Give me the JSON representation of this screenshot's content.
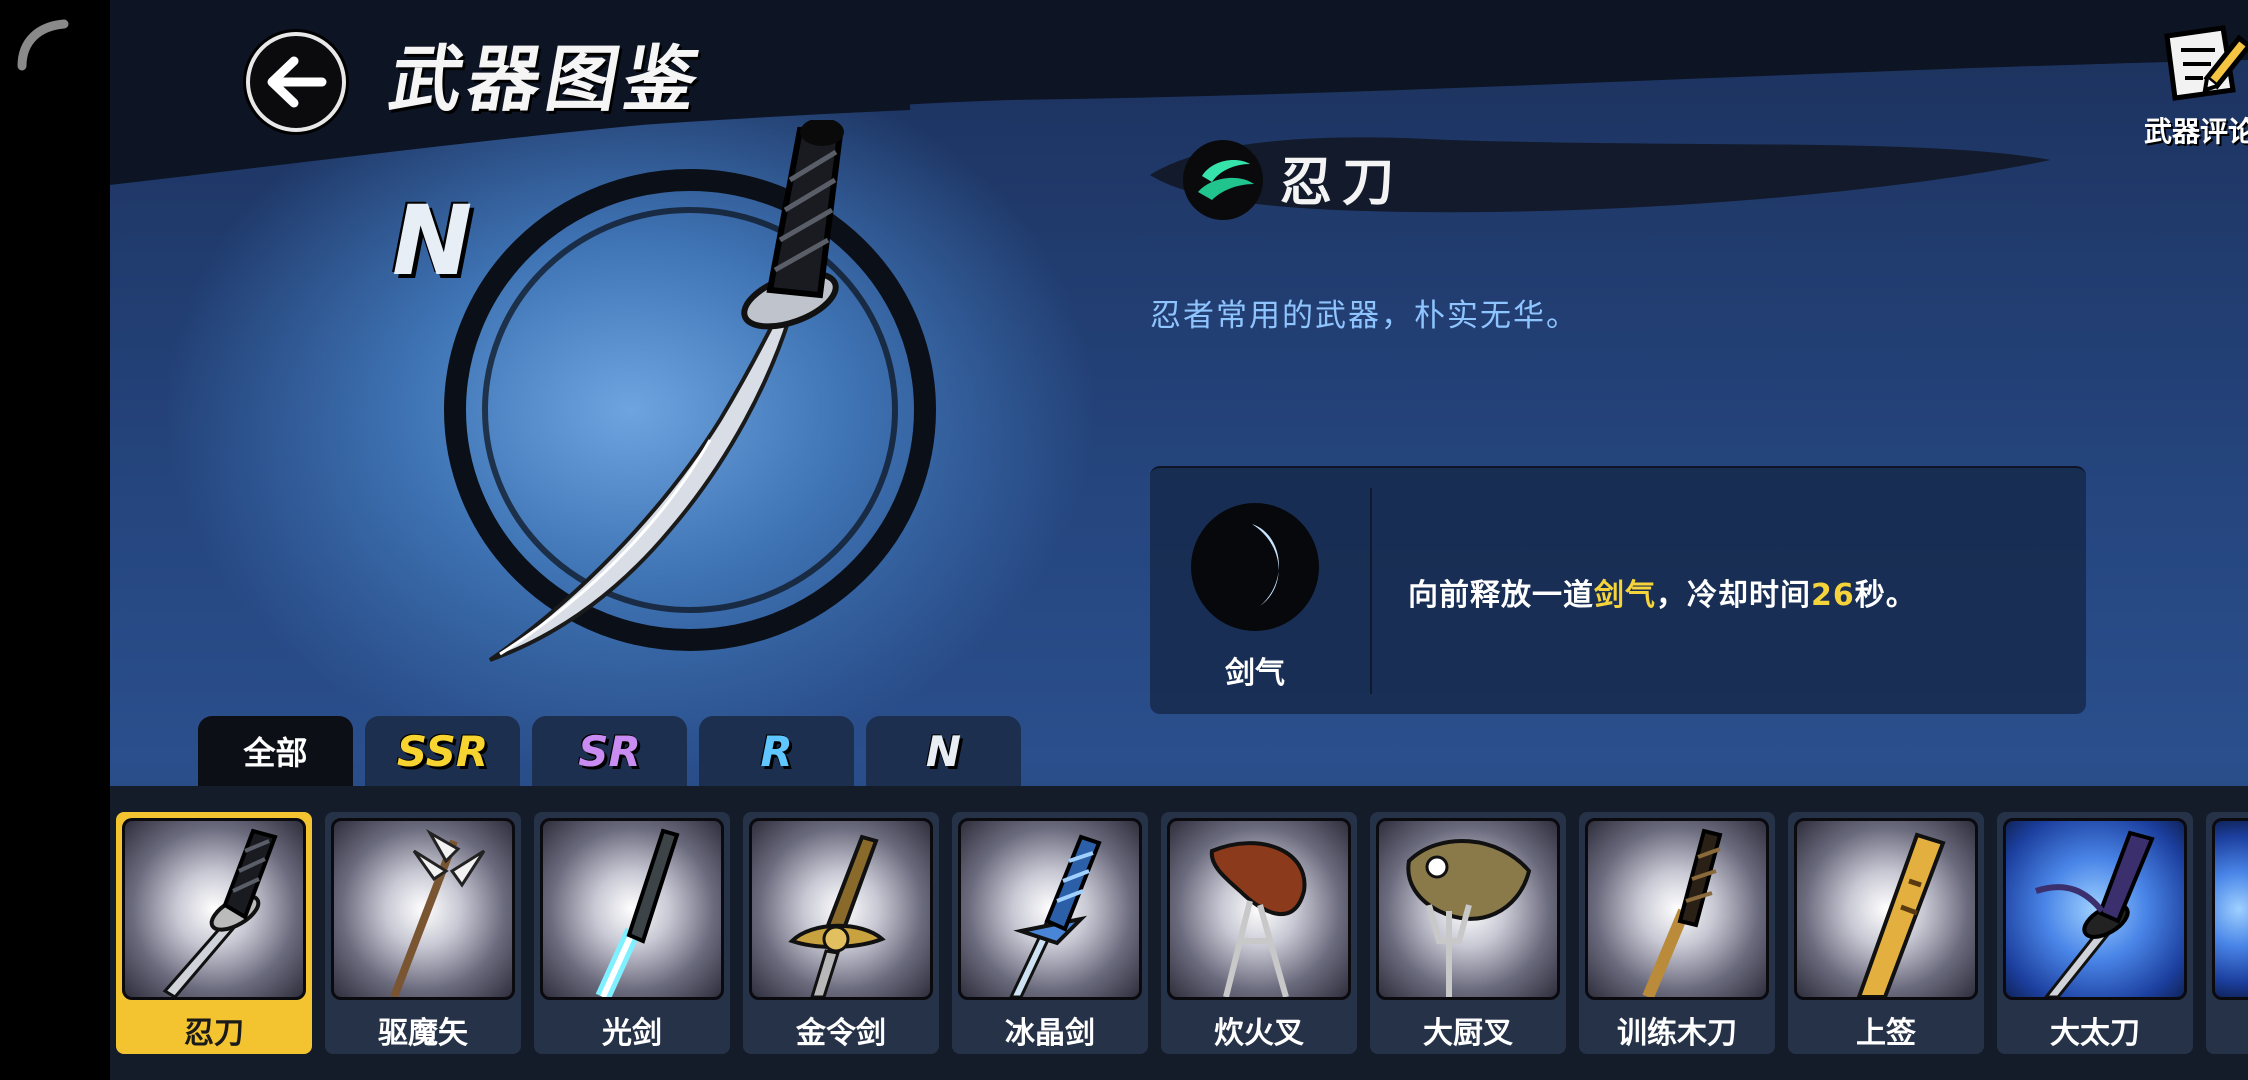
{
  "header": {
    "title": "武器图鉴",
    "review_label": "武器评论"
  },
  "weapon": {
    "rarity": "N",
    "name": "忍刀",
    "description": "忍者常用的武器，朴实无华。"
  },
  "skill": {
    "name": "剑气",
    "desc_prefix": "向前释放一道",
    "desc_highlight": "剑气",
    "desc_middle": "，冷却时间",
    "cooldown": "26",
    "desc_suffix": "秒。"
  },
  "tabs": [
    {
      "label": "全部",
      "color": "#ffffff"
    },
    {
      "label": "SSR",
      "color": "#f7d430"
    },
    {
      "label": "SR",
      "color": "#c98cf2"
    },
    {
      "label": "R",
      "color": "#5fc6ff"
    },
    {
      "label": "N",
      "color": "#e9eef4"
    }
  ],
  "weapons": [
    {
      "label": "忍刀"
    },
    {
      "label": "驱魔矢"
    },
    {
      "label": "光剑"
    },
    {
      "label": "金令剑"
    },
    {
      "label": "冰晶剑"
    },
    {
      "label": "炊火叉"
    },
    {
      "label": "大厨叉"
    },
    {
      "label": "训练木刀"
    },
    {
      "label": "上签"
    },
    {
      "label": "大太刀"
    }
  ],
  "colors": {
    "selected_card": "#f4c430",
    "highlight": "#f5d33a",
    "description": "#8fc5ff"
  }
}
